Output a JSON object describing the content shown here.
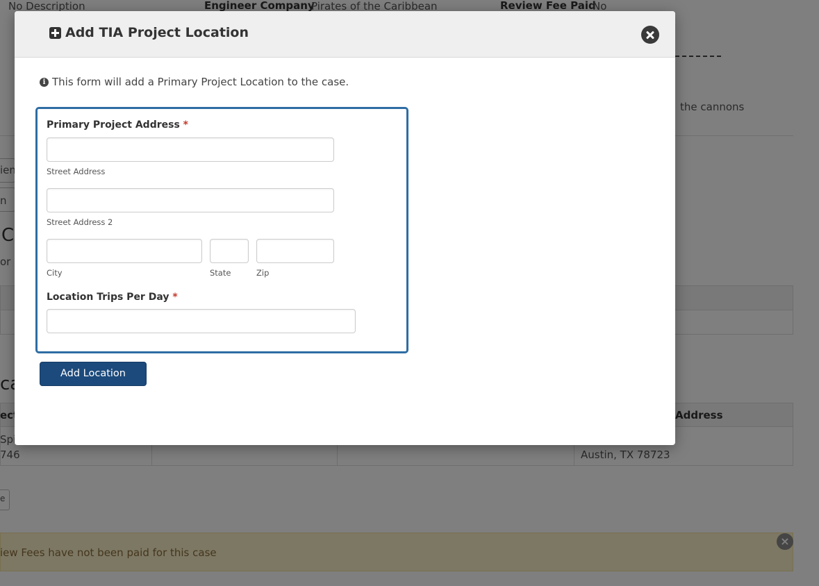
{
  "background": {
    "desc_value": "No Description",
    "engineer_company_label": "Engineer Company",
    "engineer_company_value": "Pirates of the Caribbean",
    "review_fee_paid_label": "Review Fee Paid",
    "review_fee_paid_value": "No",
    "side_text": "the cannons",
    "tab_fragment_1": "ien",
    "tab_fragment_2": "n",
    "section_fragment_1": "C",
    "section_fragment_2": "or d",
    "section_fragment_3": "cat",
    "table_col_fragment": "ect",
    "table_col_address": "Address",
    "row_fragment_1": "Spi",
    "row_fragment_2": "746",
    "row_address": "Austin, TX 78723",
    "btn_fragment": "e",
    "alert_text": "iew Fees have not been paid for this case",
    "alert_close": "×"
  },
  "modal": {
    "title": "Add TIA Project Location",
    "info_text": "This form will add a Primary Project Location to the case.",
    "primary_address_label": "Primary Project Address",
    "required_mark": "*",
    "street_label": "Street Address",
    "street2_label": "Street Address 2",
    "city_label": "City",
    "state_label": "State",
    "zip_label": "Zip",
    "trips_label": "Location Trips Per Day",
    "street_value": "",
    "street2_value": "",
    "city_value": "",
    "state_value": "",
    "zip_value": "",
    "trips_value": "",
    "submit_label": "Add Location"
  },
  "icons": {
    "title_icon": "plus-square-icon",
    "close_icon": "close-circle-icon",
    "info_icon": "info-circle-icon"
  }
}
